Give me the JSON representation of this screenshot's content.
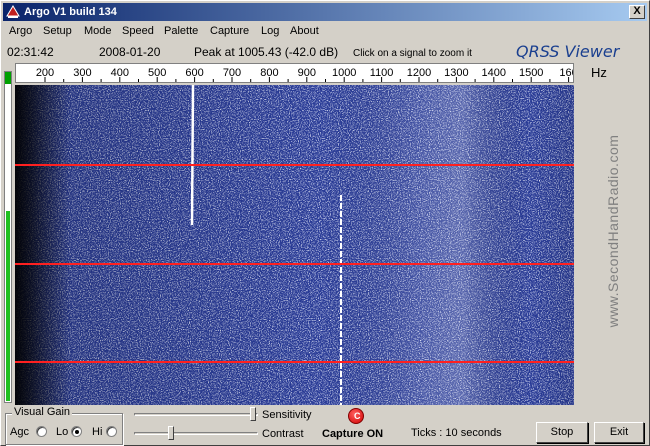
{
  "window": {
    "title": "Argo V1 build 134",
    "close_label": "X"
  },
  "menu": [
    "Argo",
    "Setup",
    "Mode",
    "Speed",
    "Palette",
    "Capture",
    "Log",
    "About"
  ],
  "info": {
    "time": "02:31:42",
    "date": "2008-01-20",
    "peak": "Peak at 1005.43 (-42.0 dB)",
    "hint": "Click on a signal to zoom it",
    "brand": "QRSS Viewer"
  },
  "scale": {
    "ticks": [
      "200",
      "300",
      "400",
      "500",
      "600",
      "700",
      "800",
      "900",
      "1000",
      "1100",
      "1200",
      "1300",
      "1400",
      "1500",
      "160"
    ],
    "unit": "Hz"
  },
  "side_brand": "www.SecondHandRadio.com",
  "controls": {
    "visual_gain_label": "Visual Gain",
    "agc_label": "Agc",
    "lo_label": "Lo",
    "hi_label": "Hi",
    "sensitivity_label": "Sensitivity",
    "contrast_label": "Contrast",
    "capture_status": "Capture ON",
    "ticks_text": "Ticks  : 10 seconds",
    "stop_label": "Stop",
    "exit_label": "Exit"
  },
  "colors": {
    "waterfall_bg": "#1a2470",
    "marker_line": "#ff2020",
    "level_meter": "#20c020"
  }
}
